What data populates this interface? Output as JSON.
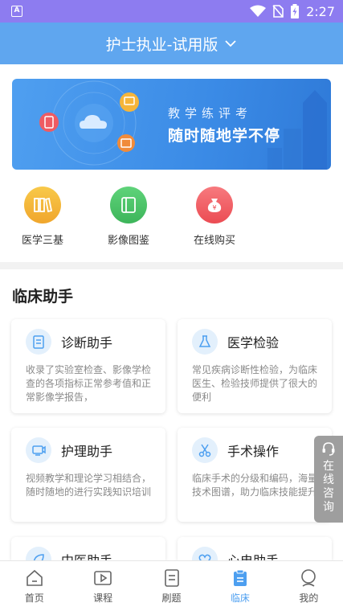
{
  "status_bar": {
    "time": "2:27",
    "notif_icon_letter": "A"
  },
  "header": {
    "title": "护士执业-试用版"
  },
  "banner": {
    "line1": "教学练评考",
    "line2": "随时随地学不停"
  },
  "quick_links": [
    {
      "label": "医学三基",
      "icon": "books-icon",
      "color": "#f3b431"
    },
    {
      "label": "影像图鉴",
      "icon": "book-icon",
      "color": "#49c265"
    },
    {
      "label": "在线购买",
      "icon": "money-bag-icon",
      "color": "#f0575c"
    }
  ],
  "section": {
    "title": "临床助手"
  },
  "cards": [
    {
      "title": "诊断助手",
      "desc": "收录了实验室检查、影像学检查的各项指标正常参考值和正常影像学报告，",
      "icon": "clipboard-icon"
    },
    {
      "title": "医学检验",
      "desc": "常见疾病诊断性检验，为临床医生、检验技师提供了很大的便利",
      "icon": "flask-icon"
    },
    {
      "title": "护理助手",
      "desc": "视频教学和理论学习相结合，随时随地的进行实践知识培训",
      "icon": "video-icon"
    },
    {
      "title": "手术操作",
      "desc": "临床手术的分级和编码，海量技术图谱，助力临床技能提升",
      "icon": "scissors-icon"
    },
    {
      "title": "中医助手",
      "desc": "",
      "icon": "leaf-icon"
    },
    {
      "title": "心电助手",
      "desc": "",
      "icon": "heart-icon"
    }
  ],
  "float_button": {
    "text": "在线咨询"
  },
  "tabs": [
    {
      "label": "首页",
      "icon": "home-icon",
      "active": false
    },
    {
      "label": "课程",
      "icon": "play-icon",
      "active": false
    },
    {
      "label": "刷题",
      "icon": "document-icon",
      "active": false
    },
    {
      "label": "临床",
      "icon": "clipboard-icon",
      "active": true
    },
    {
      "label": "我的",
      "icon": "user-icon",
      "active": false
    }
  ],
  "colors": {
    "accent": "#4d9ff0",
    "header_bg": "#5fa6ef",
    "status_bg": "#8d7cf0"
  }
}
